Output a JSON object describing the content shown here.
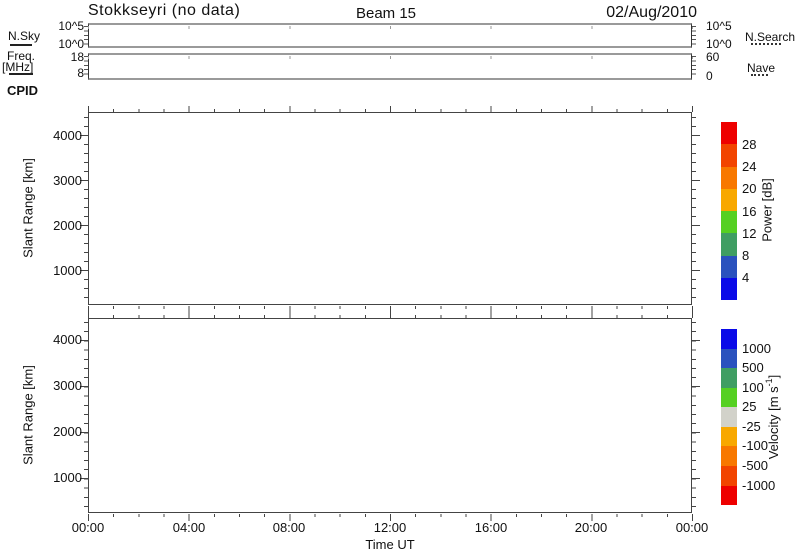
{
  "header": {
    "title": "Stokkseyri (no data)",
    "beam": "Beam 15",
    "date": "02/Aug/2010"
  },
  "top_panels": {
    "nsky": {
      "legend": "N.Sky",
      "left_ticks": [
        "10^5",
        "10^0"
      ],
      "right_ticks": [
        "10^5",
        "10^0"
      ],
      "right_legend": "N.Search"
    },
    "freq": {
      "legend_line1": "Freq.",
      "legend_line2": "[MHz]",
      "left_ticks": [
        "18",
        "8"
      ],
      "right_ticks": [
        "60",
        "0"
      ],
      "right_legend": "Nave"
    },
    "cpid": "CPID"
  },
  "power_panel": {
    "ylabel": "Slant Range [km]",
    "yticks": [
      "4000",
      "3000",
      "2000",
      "1000"
    ]
  },
  "velocity_panel": {
    "ylabel": "Slant Range [km]",
    "yticks": [
      "4000",
      "3000",
      "2000",
      "1000"
    ]
  },
  "xaxis": {
    "tick_labels": [
      "00:00",
      "04:00",
      "08:00",
      "12:00",
      "16:00",
      "20:00",
      "00:00"
    ],
    "label": "Time UT"
  },
  "power_colorbar": {
    "title": "Power [dB]",
    "tick_labels": [
      "28",
      "24",
      "20",
      "16",
      "12",
      "8",
      "4"
    ],
    "colors": [
      "#ee0000",
      "#f24400",
      "#f87800",
      "#f8a800",
      "#55d022",
      "#3f9e63",
      "#2a52be",
      "#0a0ae8"
    ]
  },
  "velocity_colorbar": {
    "title_pre": "Velocity [m s",
    "title_sup": "-1",
    "title_post": "]",
    "tick_labels": [
      "1000",
      "500",
      "100",
      "25",
      "-25",
      "-100",
      "-500",
      "-1000"
    ],
    "colors": [
      "#0a0ae8",
      "#2a52be",
      "#3f9e63",
      "#55d022",
      "#d2d2ca",
      "#f8a800",
      "#f87800",
      "#f24400",
      "#ee0000"
    ]
  },
  "chart_data": [
    {
      "type": "line",
      "title": "N.Sky / N.Search",
      "x_range": [
        "00:00",
        "24:00"
      ],
      "y_ticks": [
        "10^0",
        "10^5"
      ],
      "legend": [
        {
          "name": "N.Sky",
          "style": "solid"
        },
        {
          "name": "N.Search",
          "style": "dotted"
        }
      ],
      "series": [],
      "note": "no data plotted"
    },
    {
      "type": "line",
      "title": "Freq [MHz] / Nave",
      "x_range": [
        "00:00",
        "24:00"
      ],
      "y_ticks_left": [
        8,
        18
      ],
      "y_ticks_right": [
        0,
        60
      ],
      "legend": [
        {
          "name": "Freq. [MHz]",
          "style": "solid"
        },
        {
          "name": "Nave",
          "style": "dotted"
        }
      ],
      "series": [],
      "note": "no data plotted"
    },
    {
      "type": "heatmap",
      "title": "Power [dB]",
      "xlabel": "Time UT",
      "ylabel": "Slant Range [km]",
      "x_range": [
        "00:00",
        "24:00"
      ],
      "x_major_ticks": [
        "00:00",
        "04:00",
        "08:00",
        "12:00",
        "16:00",
        "20:00",
        "00:00"
      ],
      "y_major_ticks": [
        1000,
        2000,
        3000,
        4000
      ],
      "colorbar_levels": [
        4,
        8,
        12,
        16,
        20,
        24,
        28
      ],
      "values": [],
      "note": "no data plotted"
    },
    {
      "type": "heatmap",
      "title": "Velocity [m s-1]",
      "xlabel": "Time UT",
      "ylabel": "Slant Range [km]",
      "x_range": [
        "00:00",
        "24:00"
      ],
      "x_major_ticks": [
        "00:00",
        "04:00",
        "08:00",
        "12:00",
        "16:00",
        "20:00",
        "00:00"
      ],
      "y_major_ticks": [
        1000,
        2000,
        3000,
        4000
      ],
      "colorbar_levels": [
        -1000,
        -500,
        -100,
        -25,
        25,
        100,
        500,
        1000
      ],
      "values": [],
      "note": "no data plotted"
    }
  ]
}
